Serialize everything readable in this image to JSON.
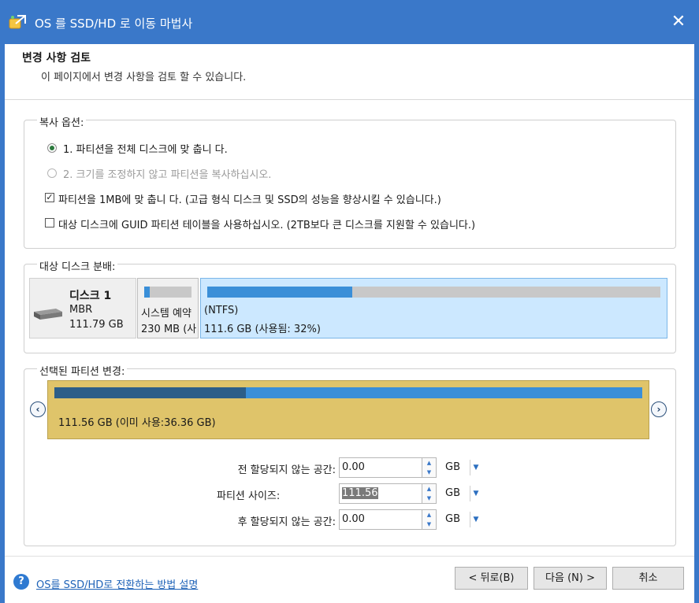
{
  "window": {
    "title": "OS 를 SSD/HD 로 이동 마법사",
    "close_glyph": "✕"
  },
  "header": {
    "title": "변경 사항 검토",
    "subtitle": "이 페이지에서 변경 사항을 검토 할 수 있습니다."
  },
  "copy_options": {
    "label": "복사 옵션:",
    "radio1": "1. 파티션을 전체 디스크에 맞 춥니 다.",
    "radio2": "2. 크기를 조정하지 않고 파티션을 복사하십시오.",
    "check1": "파티션을 1MB에 맞 춥니 다. (고급 형식 디스크 및 SSD의 성능을 향상시킬 수 있습니다.)",
    "check2": "대상 디스크에 GUID 파티션 테이블을 사용하십시오. (2TB보다 큰 디스크를 지원할 수 있습니다.)",
    "check_mark": "✓"
  },
  "disk_layout": {
    "label": "대상 디스크 분배:",
    "disk_name": "디스크 1",
    "disk_type": "MBR",
    "disk_size": "111.79 GB",
    "partitions": [
      {
        "name": "시스템 예약",
        "size": "230 MB (사",
        "used_fraction": 0.12
      },
      {
        "name": "(NTFS)",
        "size": "111.6 GB (사용됨: 32%)",
        "used_fraction": 0.32
      }
    ]
  },
  "selected_partition": {
    "label": "선택된 파티션 변경:",
    "text": "111.56 GB (이미 사용:36.36 GB)",
    "used_fraction": 0.326,
    "left_arrow": "‹",
    "right_arrow": "›"
  },
  "fields": {
    "before_label": "전 할당되지 않는 공간:",
    "before_value": "0.00",
    "size_label": "파티션 사이즈:",
    "size_value": "111.56",
    "after_label": "후 할당되지 않는 공간:",
    "after_value": "0.00",
    "unit": "GB"
  },
  "footer": {
    "help_glyph": "?",
    "help_link": "OS를 SSD/HD로 전환하는 방법 설명",
    "back_button": "< 뒤로(B)",
    "next_button": "다음 (N) >",
    "cancel_button": "취소"
  },
  "colors": {
    "title_bar": "#3a78c9",
    "partition_selected": "#dfc46a",
    "bar_fill": "#3a8fd8"
  }
}
